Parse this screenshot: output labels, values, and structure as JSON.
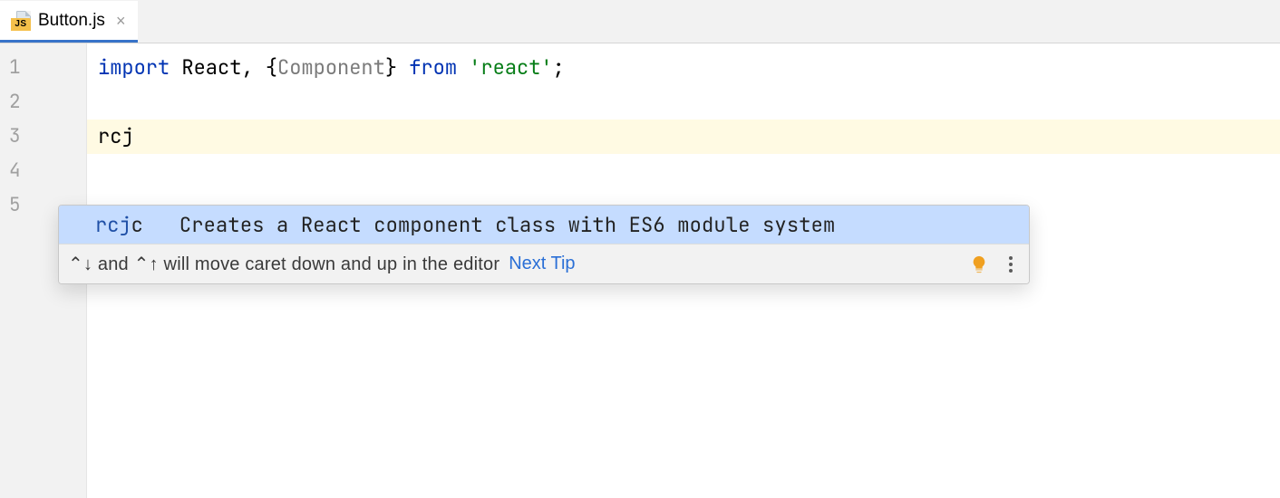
{
  "tabs": {
    "active": {
      "filename": "Button.js",
      "icon_label": "JS"
    }
  },
  "editor": {
    "line_numbers": [
      "1",
      "2",
      "3",
      "4",
      "5"
    ],
    "code": {
      "l1": {
        "kw1": "import",
        "id1": " React",
        "p1": ", ",
        "brace_l": "{",
        "id2": "Component",
        "brace_r": "}",
        "kw2": " from ",
        "str": "'react'",
        "p2": ";"
      },
      "l3_text": "rcj"
    }
  },
  "completion": {
    "item": {
      "name_match": "rcj",
      "name_rest": "c",
      "description": "Creates a React component class with ES6 module system"
    },
    "footer": {
      "hint": "⌃↓ and ⌃↑ will move caret down and up in the editor",
      "next_tip": "Next Tip"
    }
  }
}
